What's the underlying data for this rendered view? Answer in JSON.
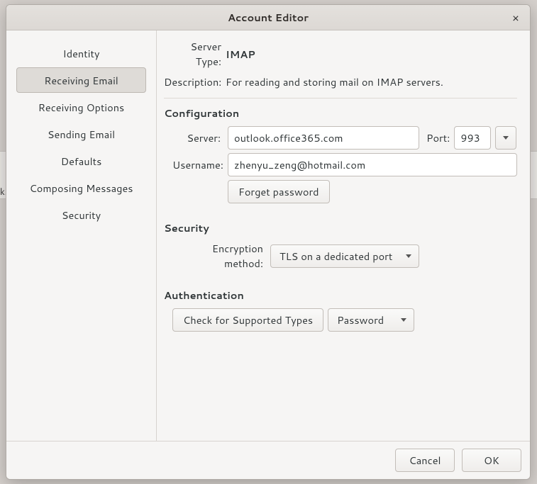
{
  "window": {
    "title": "Account Editor",
    "close": "×"
  },
  "sidebar": {
    "items": [
      {
        "label": "Identity"
      },
      {
        "label": "Receiving Email"
      },
      {
        "label": "Receiving Options"
      },
      {
        "label": "Sending Email"
      },
      {
        "label": "Defaults"
      },
      {
        "label": "Composing Messages"
      },
      {
        "label": "Security"
      }
    ],
    "selected_index": 1
  },
  "info": {
    "server_type_label": "Server Type:",
    "server_type_value": "IMAP",
    "description_label": "Description:",
    "description_value": "For reading and storing mail on IMAP servers."
  },
  "configuration": {
    "heading": "Configuration",
    "server_label": "Server:",
    "server_value": "outlook.office365.com",
    "port_label": "Port:",
    "port_value": "993",
    "username_label": "Username:",
    "username_value": "zhenyu_zeng@hotmail.com",
    "forget_password": "Forget password"
  },
  "security": {
    "heading": "Security",
    "encryption_label": "Encryption method:",
    "encryption_value": "TLS on a dedicated port"
  },
  "authentication": {
    "heading": "Authentication",
    "check_types": "Check for Supported Types",
    "method_value": "Password"
  },
  "footer": {
    "cancel": "Cancel",
    "ok": "OK"
  },
  "backdrop_text": "k."
}
